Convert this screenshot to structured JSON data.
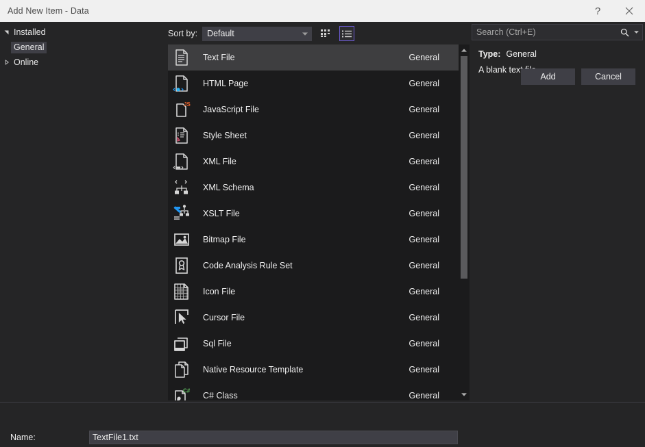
{
  "titlebar": {
    "title": "Add New Item - Data",
    "help_label": "?",
    "close_label": "Close"
  },
  "tree": {
    "nodes": [
      {
        "label": "Installed",
        "level": 1,
        "expanded": true,
        "selected": false
      },
      {
        "label": "General",
        "level": 2,
        "expanded": null,
        "selected": true
      },
      {
        "label": "Online",
        "level": 1,
        "expanded": false,
        "selected": false
      }
    ]
  },
  "toolbar": {
    "sort_by_label": "Sort by:",
    "sort_by_value": "Default",
    "grid_view_name": "grid-view",
    "list_view_name": "list-view",
    "active_view": "list-view"
  },
  "search": {
    "placeholder": "Search (Ctrl+E)",
    "value": ""
  },
  "details": {
    "type_key": "Type:",
    "type_value": "General",
    "description": "A blank text file."
  },
  "list": {
    "selected_index": 0,
    "items": [
      {
        "name": "Text File",
        "category": "General",
        "icon": "text-file-icon"
      },
      {
        "name": "HTML Page",
        "category": "General",
        "icon": "html-page-icon"
      },
      {
        "name": "JavaScript File",
        "category": "General",
        "icon": "javascript-file-icon"
      },
      {
        "name": "Style Sheet",
        "category": "General",
        "icon": "style-sheet-icon"
      },
      {
        "name": "XML File",
        "category": "General",
        "icon": "xml-file-icon"
      },
      {
        "name": "XML Schema",
        "category": "General",
        "icon": "xml-schema-icon"
      },
      {
        "name": "XSLT File",
        "category": "General",
        "icon": "xslt-file-icon"
      },
      {
        "name": "Bitmap File",
        "category": "General",
        "icon": "bitmap-file-icon"
      },
      {
        "name": "Code Analysis Rule Set",
        "category": "General",
        "icon": "code-analysis-rule-set-icon"
      },
      {
        "name": "Icon File",
        "category": "General",
        "icon": "icon-file-icon"
      },
      {
        "name": "Cursor File",
        "category": "General",
        "icon": "cursor-file-icon"
      },
      {
        "name": "Sql File",
        "category": "General",
        "icon": "sql-file-icon"
      },
      {
        "name": "Native Resource Template",
        "category": "General",
        "icon": "native-resource-template-icon"
      },
      {
        "name": "C# Class",
        "category": "General",
        "icon": "csharp-class-icon"
      }
    ]
  },
  "footer": {
    "name_label": "Name:",
    "name_value": "TextFile1.txt",
    "add_label": "Add",
    "cancel_label": "Cancel"
  },
  "colors": {
    "dialog_bg": "#252526",
    "list_bg": "#1b1b1c",
    "selection": "#3e3e40",
    "titlebar_bg": "#f0f0f0",
    "accent": "#6a5acd",
    "control_bg": "#3f3f46",
    "text": "#f0f0f0"
  }
}
